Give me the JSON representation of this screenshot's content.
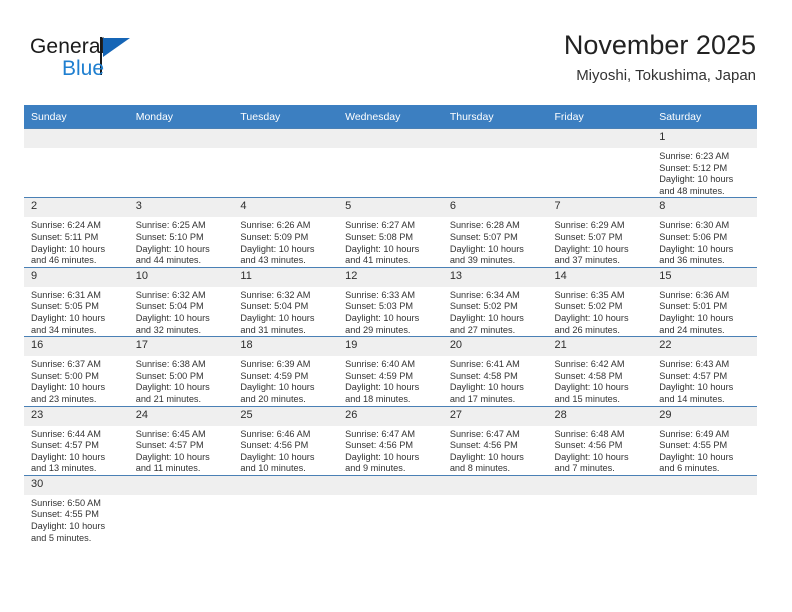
{
  "brand": {
    "name_top": "General",
    "name_bottom": "Blue",
    "accent_color": "#1f7fd0",
    "flag_color": "#1565b6"
  },
  "header": {
    "title": "November 2025",
    "subtitle": "Miyoshi, Tokushima, Japan"
  },
  "calendar": {
    "header_bg": "#3c7fc1",
    "header_text_color": "#ffffff",
    "grid_line_color": "#4a80b5",
    "daynum_bg": "#efefef",
    "weekdays": [
      "Sunday",
      "Monday",
      "Tuesday",
      "Wednesday",
      "Thursday",
      "Friday",
      "Saturday"
    ],
    "weeks": [
      [
        {
          "day": "",
          "sunrise": "",
          "sunset": "",
          "daylight_line1": "",
          "daylight_line2": ""
        },
        {
          "day": "",
          "sunrise": "",
          "sunset": "",
          "daylight_line1": "",
          "daylight_line2": ""
        },
        {
          "day": "",
          "sunrise": "",
          "sunset": "",
          "daylight_line1": "",
          "daylight_line2": ""
        },
        {
          "day": "",
          "sunrise": "",
          "sunset": "",
          "daylight_line1": "",
          "daylight_line2": ""
        },
        {
          "day": "",
          "sunrise": "",
          "sunset": "",
          "daylight_line1": "",
          "daylight_line2": ""
        },
        {
          "day": "",
          "sunrise": "",
          "sunset": "",
          "daylight_line1": "",
          "daylight_line2": ""
        },
        {
          "day": "1",
          "sunrise": "Sunrise: 6:23 AM",
          "sunset": "Sunset: 5:12 PM",
          "daylight_line1": "Daylight: 10 hours",
          "daylight_line2": "and 48 minutes."
        }
      ],
      [
        {
          "day": "2",
          "sunrise": "Sunrise: 6:24 AM",
          "sunset": "Sunset: 5:11 PM",
          "daylight_line1": "Daylight: 10 hours",
          "daylight_line2": "and 46 minutes."
        },
        {
          "day": "3",
          "sunrise": "Sunrise: 6:25 AM",
          "sunset": "Sunset: 5:10 PM",
          "daylight_line1": "Daylight: 10 hours",
          "daylight_line2": "and 44 minutes."
        },
        {
          "day": "4",
          "sunrise": "Sunrise: 6:26 AM",
          "sunset": "Sunset: 5:09 PM",
          "daylight_line1": "Daylight: 10 hours",
          "daylight_line2": "and 43 minutes."
        },
        {
          "day": "5",
          "sunrise": "Sunrise: 6:27 AM",
          "sunset": "Sunset: 5:08 PM",
          "daylight_line1": "Daylight: 10 hours",
          "daylight_line2": "and 41 minutes."
        },
        {
          "day": "6",
          "sunrise": "Sunrise: 6:28 AM",
          "sunset": "Sunset: 5:07 PM",
          "daylight_line1": "Daylight: 10 hours",
          "daylight_line2": "and 39 minutes."
        },
        {
          "day": "7",
          "sunrise": "Sunrise: 6:29 AM",
          "sunset": "Sunset: 5:07 PM",
          "daylight_line1": "Daylight: 10 hours",
          "daylight_line2": "and 37 minutes."
        },
        {
          "day": "8",
          "sunrise": "Sunrise: 6:30 AM",
          "sunset": "Sunset: 5:06 PM",
          "daylight_line1": "Daylight: 10 hours",
          "daylight_line2": "and 36 minutes."
        }
      ],
      [
        {
          "day": "9",
          "sunrise": "Sunrise: 6:31 AM",
          "sunset": "Sunset: 5:05 PM",
          "daylight_line1": "Daylight: 10 hours",
          "daylight_line2": "and 34 minutes."
        },
        {
          "day": "10",
          "sunrise": "Sunrise: 6:32 AM",
          "sunset": "Sunset: 5:04 PM",
          "daylight_line1": "Daylight: 10 hours",
          "daylight_line2": "and 32 minutes."
        },
        {
          "day": "11",
          "sunrise": "Sunrise: 6:32 AM",
          "sunset": "Sunset: 5:04 PM",
          "daylight_line1": "Daylight: 10 hours",
          "daylight_line2": "and 31 minutes."
        },
        {
          "day": "12",
          "sunrise": "Sunrise: 6:33 AM",
          "sunset": "Sunset: 5:03 PM",
          "daylight_line1": "Daylight: 10 hours",
          "daylight_line2": "and 29 minutes."
        },
        {
          "day": "13",
          "sunrise": "Sunrise: 6:34 AM",
          "sunset": "Sunset: 5:02 PM",
          "daylight_line1": "Daylight: 10 hours",
          "daylight_line2": "and 27 minutes."
        },
        {
          "day": "14",
          "sunrise": "Sunrise: 6:35 AM",
          "sunset": "Sunset: 5:02 PM",
          "daylight_line1": "Daylight: 10 hours",
          "daylight_line2": "and 26 minutes."
        },
        {
          "day": "15",
          "sunrise": "Sunrise: 6:36 AM",
          "sunset": "Sunset: 5:01 PM",
          "daylight_line1": "Daylight: 10 hours",
          "daylight_line2": "and 24 minutes."
        }
      ],
      [
        {
          "day": "16",
          "sunrise": "Sunrise: 6:37 AM",
          "sunset": "Sunset: 5:00 PM",
          "daylight_line1": "Daylight: 10 hours",
          "daylight_line2": "and 23 minutes."
        },
        {
          "day": "17",
          "sunrise": "Sunrise: 6:38 AM",
          "sunset": "Sunset: 5:00 PM",
          "daylight_line1": "Daylight: 10 hours",
          "daylight_line2": "and 21 minutes."
        },
        {
          "day": "18",
          "sunrise": "Sunrise: 6:39 AM",
          "sunset": "Sunset: 4:59 PM",
          "daylight_line1": "Daylight: 10 hours",
          "daylight_line2": "and 20 minutes."
        },
        {
          "day": "19",
          "sunrise": "Sunrise: 6:40 AM",
          "sunset": "Sunset: 4:59 PM",
          "daylight_line1": "Daylight: 10 hours",
          "daylight_line2": "and 18 minutes."
        },
        {
          "day": "20",
          "sunrise": "Sunrise: 6:41 AM",
          "sunset": "Sunset: 4:58 PM",
          "daylight_line1": "Daylight: 10 hours",
          "daylight_line2": "and 17 minutes."
        },
        {
          "day": "21",
          "sunrise": "Sunrise: 6:42 AM",
          "sunset": "Sunset: 4:58 PM",
          "daylight_line1": "Daylight: 10 hours",
          "daylight_line2": "and 15 minutes."
        },
        {
          "day": "22",
          "sunrise": "Sunrise: 6:43 AM",
          "sunset": "Sunset: 4:57 PM",
          "daylight_line1": "Daylight: 10 hours",
          "daylight_line2": "and 14 minutes."
        }
      ],
      [
        {
          "day": "23",
          "sunrise": "Sunrise: 6:44 AM",
          "sunset": "Sunset: 4:57 PM",
          "daylight_line1": "Daylight: 10 hours",
          "daylight_line2": "and 13 minutes."
        },
        {
          "day": "24",
          "sunrise": "Sunrise: 6:45 AM",
          "sunset": "Sunset: 4:57 PM",
          "daylight_line1": "Daylight: 10 hours",
          "daylight_line2": "and 11 minutes."
        },
        {
          "day": "25",
          "sunrise": "Sunrise: 6:46 AM",
          "sunset": "Sunset: 4:56 PM",
          "daylight_line1": "Daylight: 10 hours",
          "daylight_line2": "and 10 minutes."
        },
        {
          "day": "26",
          "sunrise": "Sunrise: 6:47 AM",
          "sunset": "Sunset: 4:56 PM",
          "daylight_line1": "Daylight: 10 hours",
          "daylight_line2": "and 9 minutes."
        },
        {
          "day": "27",
          "sunrise": "Sunrise: 6:47 AM",
          "sunset": "Sunset: 4:56 PM",
          "daylight_line1": "Daylight: 10 hours",
          "daylight_line2": "and 8 minutes."
        },
        {
          "day": "28",
          "sunrise": "Sunrise: 6:48 AM",
          "sunset": "Sunset: 4:56 PM",
          "daylight_line1": "Daylight: 10 hours",
          "daylight_line2": "and 7 minutes."
        },
        {
          "day": "29",
          "sunrise": "Sunrise: 6:49 AM",
          "sunset": "Sunset: 4:55 PM",
          "daylight_line1": "Daylight: 10 hours",
          "daylight_line2": "and 6 minutes."
        }
      ],
      [
        {
          "day": "30",
          "sunrise": "Sunrise: 6:50 AM",
          "sunset": "Sunset: 4:55 PM",
          "daylight_line1": "Daylight: 10 hours",
          "daylight_line2": "and 5 minutes."
        },
        {
          "day": "",
          "sunrise": "",
          "sunset": "",
          "daylight_line1": "",
          "daylight_line2": ""
        },
        {
          "day": "",
          "sunrise": "",
          "sunset": "",
          "daylight_line1": "",
          "daylight_line2": ""
        },
        {
          "day": "",
          "sunrise": "",
          "sunset": "",
          "daylight_line1": "",
          "daylight_line2": ""
        },
        {
          "day": "",
          "sunrise": "",
          "sunset": "",
          "daylight_line1": "",
          "daylight_line2": ""
        },
        {
          "day": "",
          "sunrise": "",
          "sunset": "",
          "daylight_line1": "",
          "daylight_line2": ""
        },
        {
          "day": "",
          "sunrise": "",
          "sunset": "",
          "daylight_line1": "",
          "daylight_line2": ""
        }
      ]
    ]
  }
}
